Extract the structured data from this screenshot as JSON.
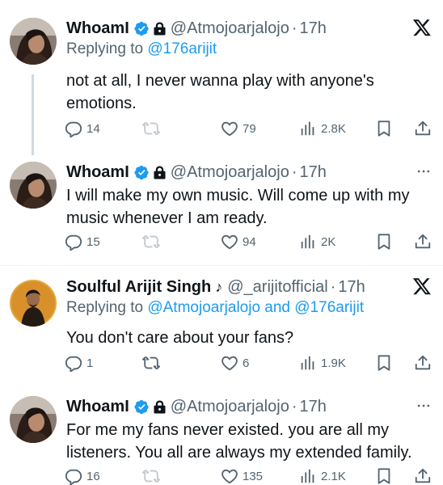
{
  "tweets": [
    {
      "name": "WhoamI",
      "handle": "@Atmojoarjalojo",
      "time": "17h",
      "replying_prefix": "Replying to",
      "replying_to": "@176arijit",
      "text": "not at all, I never wanna play with anyone's emotions.",
      "replies": "14",
      "retweets": "",
      "likes": "79",
      "views": "2.8K"
    },
    {
      "name": "WhoamI",
      "handle": "@Atmojoarjalojo",
      "time": "17h",
      "text": "I will make my own music. Will come up with my music whenever I am ready.",
      "replies": "15",
      "retweets": "",
      "likes": "94",
      "views": "2K"
    },
    {
      "name": "Soulful Arijit Singh",
      "name_symbol": "♪",
      "handle": "@_arijitofficial",
      "time": "17h",
      "replying_prefix": "Replying to",
      "replying_to": "@Atmojoarjalojo and @176arijit",
      "text": "You don't care about your fans?",
      "replies": "1",
      "retweets": "",
      "likes": "6",
      "views": "1.9K"
    },
    {
      "name": "WhoamI",
      "handle": "@Atmojoarjalojo",
      "time": "17h",
      "text": "For me my fans never existed. you are all my listeners. You all are always my extended family.",
      "replies": "16",
      "retweets": "",
      "likes": "135",
      "views": "2.1K"
    }
  ],
  "icons": {
    "verified": "verified-badge-icon",
    "lock": "lock-icon",
    "x_logo": "x-logo-icon",
    "more": "more-icon",
    "reply": "reply-icon",
    "retweet": "retweet-icon",
    "like": "like-icon",
    "views": "views-icon",
    "bookmark": "bookmark-icon",
    "share": "share-icon"
  },
  "colors": {
    "link": "#1d9bf0",
    "verified": "#1d9bf0",
    "secondary_text": "#536471",
    "primary_text": "#0f1419"
  }
}
